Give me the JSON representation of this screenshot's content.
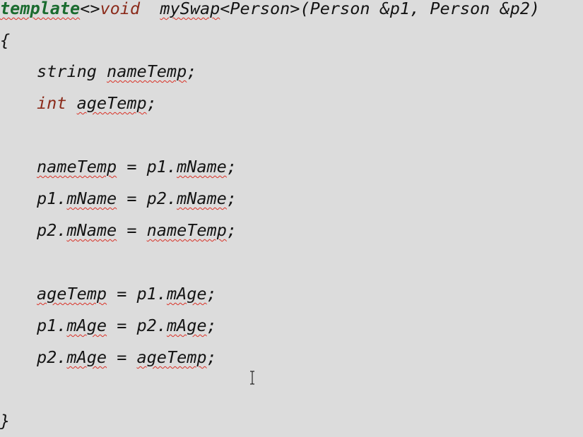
{
  "editor": {
    "lines": [
      {
        "indent": 0,
        "tokens": [
          {
            "text": "template",
            "cls": "kw-green squiggle"
          },
          {
            "text": "<>",
            "cls": "plain"
          },
          {
            "text": "void",
            "cls": "kw-red"
          },
          {
            "text": "  ",
            "cls": "plain"
          },
          {
            "text": "mySwap",
            "cls": "plain squiggle"
          },
          {
            "text": "<Person>(Person &p1, Person &p2)",
            "cls": "plain"
          }
        ]
      },
      {
        "indent": 0,
        "tokens": [
          {
            "text": "{",
            "cls": "plain"
          }
        ]
      },
      {
        "indent": 1,
        "tokens": [
          {
            "text": "string ",
            "cls": "plain"
          },
          {
            "text": "nameTemp",
            "cls": "plain squiggle"
          },
          {
            "text": ";",
            "cls": "plain"
          }
        ]
      },
      {
        "indent": 1,
        "tokens": [
          {
            "text": "int",
            "cls": "kw-red"
          },
          {
            "text": " ",
            "cls": "plain"
          },
          {
            "text": "ageTemp",
            "cls": "plain squiggle"
          },
          {
            "text": ";",
            "cls": "plain"
          }
        ]
      },
      {
        "indent": 0,
        "tokens": []
      },
      {
        "indent": 1,
        "tokens": [
          {
            "text": "nameTemp",
            "cls": "plain squiggle"
          },
          {
            "text": " = p1.",
            "cls": "plain"
          },
          {
            "text": "mName",
            "cls": "plain squiggle"
          },
          {
            "text": ";",
            "cls": "plain"
          }
        ]
      },
      {
        "indent": 1,
        "tokens": [
          {
            "text": "p1.",
            "cls": "plain"
          },
          {
            "text": "mName",
            "cls": "plain squiggle"
          },
          {
            "text": " = p2.",
            "cls": "plain"
          },
          {
            "text": "mName",
            "cls": "plain squiggle"
          },
          {
            "text": ";",
            "cls": "plain"
          }
        ]
      },
      {
        "indent": 1,
        "tokens": [
          {
            "text": "p2.",
            "cls": "plain"
          },
          {
            "text": "mName",
            "cls": "plain squiggle"
          },
          {
            "text": " = ",
            "cls": "plain"
          },
          {
            "text": "nameTemp",
            "cls": "plain squiggle"
          },
          {
            "text": ";",
            "cls": "plain"
          }
        ]
      },
      {
        "indent": 0,
        "tokens": []
      },
      {
        "indent": 1,
        "tokens": [
          {
            "text": "ageTemp",
            "cls": "plain squiggle"
          },
          {
            "text": " = p1.",
            "cls": "plain"
          },
          {
            "text": "mAge",
            "cls": "plain squiggle"
          },
          {
            "text": ";",
            "cls": "plain"
          }
        ]
      },
      {
        "indent": 1,
        "tokens": [
          {
            "text": "p1.",
            "cls": "plain"
          },
          {
            "text": "mAge",
            "cls": "plain squiggle"
          },
          {
            "text": " = p2.",
            "cls": "plain"
          },
          {
            "text": "mAge",
            "cls": "plain squiggle"
          },
          {
            "text": ";",
            "cls": "plain"
          }
        ]
      },
      {
        "indent": 1,
        "tokens": [
          {
            "text": "p2.",
            "cls": "plain"
          },
          {
            "text": "mAge",
            "cls": "plain squiggle"
          },
          {
            "text": " = ",
            "cls": "plain"
          },
          {
            "text": "ageTemp",
            "cls": "plain squiggle"
          },
          {
            "text": ";",
            "cls": "plain"
          }
        ]
      },
      {
        "indent": 0,
        "tokens": []
      },
      {
        "indent": 0,
        "tokens": [
          {
            "text": "}",
            "cls": "plain"
          }
        ]
      }
    ],
    "colors": {
      "background": "#dcdcdc",
      "keyword_template": "#1a6b2f",
      "keyword_type": "#8b2b1b",
      "text": "#141414",
      "squiggle": "#d93025"
    },
    "cursor_icon": "text-ibeam-icon"
  }
}
